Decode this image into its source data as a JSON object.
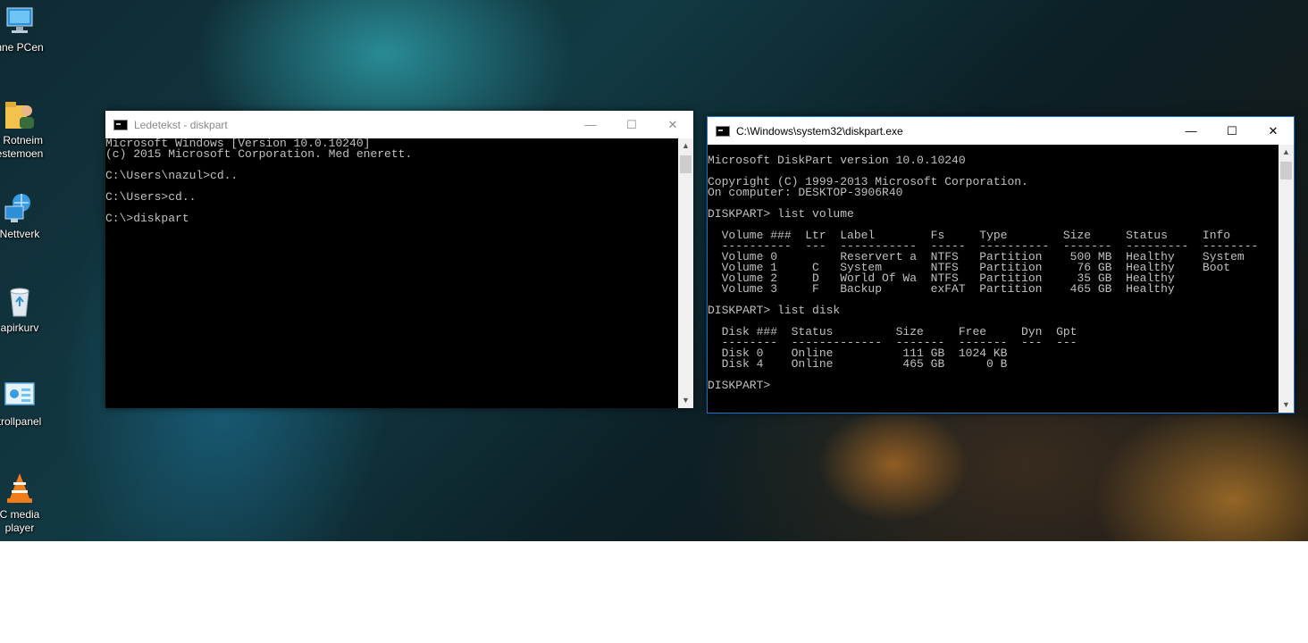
{
  "desktop": {
    "icons": [
      {
        "label": "nne PCen",
        "icon": "computer-icon"
      },
      {
        "label": "r Rotneim\nestemoen",
        "icon": "user-folder-icon"
      },
      {
        "label": "Nettverk",
        "icon": "network-icon"
      },
      {
        "label": "apirkurv",
        "icon": "recycle-bin-icon"
      },
      {
        "label": "trollpanel",
        "icon": "control-panel-icon"
      },
      {
        "label": "C media\nplayer",
        "icon": "vlc-icon"
      }
    ]
  },
  "cmd_window": {
    "title": "Ledetekst - diskpart",
    "lines": [
      "Microsoft Windows [Version 10.0.10240]",
      "(c) 2015 Microsoft Corporation. Med enerett.",
      "",
      "C:\\Users\\nazul>cd..",
      "",
      "C:\\Users>cd..",
      "",
      "C:\\>diskpart"
    ]
  },
  "diskpart_window": {
    "title": "C:\\Windows\\system32\\diskpart.exe",
    "lines": [
      "",
      "Microsoft DiskPart version 10.0.10240",
      "",
      "Copyright (C) 1999-2013 Microsoft Corporation.",
      "On computer: DESKTOP-3906R40",
      "",
      "DISKPART> list volume",
      "",
      "  Volume ###  Ltr  Label        Fs     Type        Size     Status     Info",
      "  ----------  ---  -----------  -----  ----------  -------  ---------  --------",
      "  Volume 0         Reservert a  NTFS   Partition    500 MB  Healthy    System",
      "  Volume 1     C   System       NTFS   Partition     76 GB  Healthy    Boot",
      "  Volume 2     D   World Of Wa  NTFS   Partition     35 GB  Healthy",
      "  Volume 3     F   Backup       exFAT  Partition    465 GB  Healthy",
      "",
      "DISKPART> list disk",
      "",
      "  Disk ###  Status         Size     Free     Dyn  Gpt",
      "  --------  -------------  -------  -------  ---  ---",
      "  Disk 0    Online          111 GB  1024 KB",
      "  Disk 4    Online          465 GB      0 B",
      "",
      "DISKPART> "
    ]
  },
  "controls": {
    "minimize": "—",
    "maximize": "☐",
    "close": "✕",
    "scroll_up": "▲",
    "scroll_down": "▼"
  }
}
